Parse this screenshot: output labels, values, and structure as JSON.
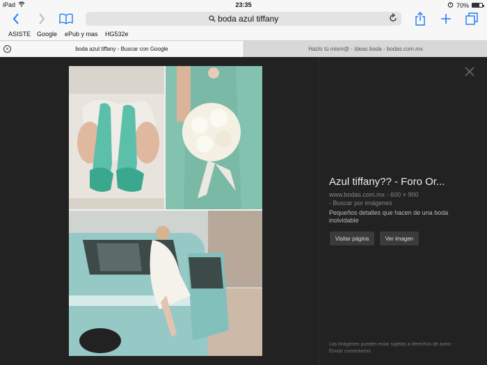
{
  "status": {
    "device": "iPad",
    "time": "23:35",
    "battery": "70%",
    "battery_level": 0.7
  },
  "toolbar": {
    "search_query": "boda azul tiffany"
  },
  "bookmarks": [
    "ASISTE",
    "Google",
    "ePub y mas",
    "HG532e"
  ],
  "tabs": [
    {
      "label": "boda azul tiffany - Buscar con Google"
    },
    {
      "label": "Hazlo tú mism@ - Ideas boda - bodas.com.mx"
    }
  ],
  "result": {
    "title": "Azul tiffany?? - Foro Or...",
    "source": "www.bodas.com.mx",
    "dimensions": "600 × 900",
    "search_by_image": "Buscar por imágenes",
    "description": "Pequeños detalles que hacen de una boda inolvidable",
    "visit_label": "Visitar página",
    "view_label": "Ver imagen",
    "copyright": "Las imágenes pueden estar sujetas a derechos de autor.",
    "feedback": "Enviar comentarios"
  },
  "colors": {
    "accent": "#1a7cf5",
    "tiffany": "#8ec9c0",
    "viewer_bg": "#222222"
  }
}
